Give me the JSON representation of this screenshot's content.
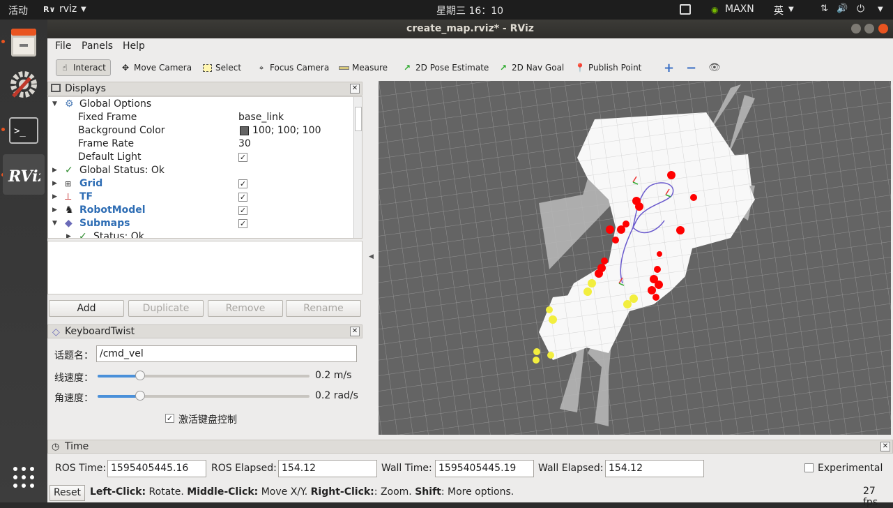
{
  "topbar": {
    "activities": "活动",
    "app_name": "rviz",
    "clock": "星期三 16：10",
    "power_mode": "MAXN",
    "input_method": "英"
  },
  "window": {
    "title": "create_map.rviz* - RViz"
  },
  "menu": {
    "file": "File",
    "panels": "Panels",
    "help": "Help"
  },
  "toolbar": {
    "interact": "Interact",
    "move_camera": "Move Camera",
    "select": "Select",
    "focus_camera": "Focus Camera",
    "measure": "Measure",
    "pose_estimate": "2D Pose Estimate",
    "nav_goal": "2D Nav Goal",
    "publish_point": "Publish Point"
  },
  "displays": {
    "title": "Displays",
    "global_options": "Global Options",
    "fixed_frame_label": "Fixed Frame",
    "fixed_frame_value": "base_link",
    "bg_color_label": "Background Color",
    "bg_color_value": "100; 100; 100",
    "frame_rate_label": "Frame Rate",
    "frame_rate_value": "30",
    "default_light_label": "Default Light",
    "global_status": "Global Status: Ok",
    "grid": "Grid",
    "tf": "TF",
    "robot_model": "RobotModel",
    "submaps": "Submaps",
    "status_ok": "Status: Ok",
    "checkbox_mark": "✓",
    "add": "Add",
    "duplicate": "Duplicate",
    "remove": "Remove",
    "rename": "Rename"
  },
  "keyboard_twist": {
    "title": "KeyboardTwist",
    "topic_label": "话题名：",
    "topic_value": "/cmd_vel",
    "linear_label": "线速度：",
    "linear_value": "0.2 m/s",
    "linear_level": 0.2,
    "angular_label": "角速度：",
    "angular_value": "0.2 rad/s",
    "angular_level": 0.2,
    "activate_label": "激活键盘控制"
  },
  "time": {
    "title": "Time",
    "ros_time_label": "ROS Time:",
    "ros_time_value": "1595405445.16",
    "ros_elapsed_label": "ROS Elapsed:",
    "ros_elapsed_value": "154.12",
    "wall_time_label": "Wall Time:",
    "wall_time_value": "1595405445.19",
    "wall_elapsed_label": "Wall Elapsed:",
    "wall_elapsed_value": "154.12",
    "experimental_label": "Experimental"
  },
  "status": {
    "reset": "Reset",
    "left_click_key": "Left-Click:",
    "left_click_text": " Rotate. ",
    "middle_click_key": "Middle-Click:",
    "middle_click_text": " Move X/Y. ",
    "right_click_key": "Right-Click:",
    "right_click_text": ": Zoom. ",
    "shift_key": "Shift",
    "shift_text": ": More options.",
    "fps": "27 fps"
  },
  "colors": {
    "accent": "#e95420",
    "selection_blue": "#4a90d9",
    "scan_red": "#ff0000",
    "scan_yellow": "#ffff33"
  }
}
